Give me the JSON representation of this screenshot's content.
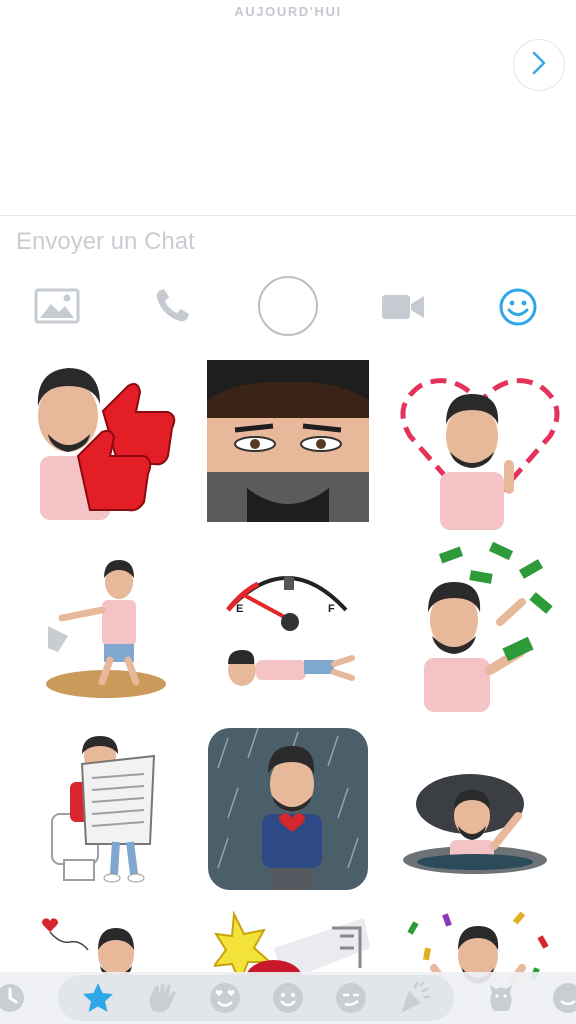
{
  "chat": {
    "date_label": "AUJOURD'HUI",
    "input_placeholder": "Envoyer un Chat"
  },
  "toolbar": {
    "icons": [
      "image-icon",
      "phone-icon",
      "capture-button",
      "video-icon",
      "smiley-icon"
    ],
    "active": "smiley-icon",
    "active_color": "#2fa6e8"
  },
  "stickers": [
    {
      "name": "thumbs-up-foam-finger-sticker"
    },
    {
      "name": "eyes-closeup-sticker"
    },
    {
      "name": "heart-outline-sticker"
    },
    {
      "name": "kick-sticker"
    },
    {
      "name": "empty-fuel-gauge-sticker"
    },
    {
      "name": "money-rain-sticker"
    },
    {
      "name": "toilet-newspaper-sticker"
    },
    {
      "name": "rain-broken-heart-sticker"
    },
    {
      "name": "manhole-wave-sticker"
    },
    {
      "name": "balloon-heart-sticker"
    },
    {
      "name": "crash-explosion-sticker"
    },
    {
      "name": "confetti-celebration-sticker"
    }
  ],
  "tray": {
    "icons": [
      "recent-clock-icon",
      "favorites-star-icon",
      "waving-hand-icon",
      "heart-eyes-face-icon",
      "smiling-face-icon",
      "smirking-face-icon",
      "party-popper-icon",
      "hamster-icon",
      "more-face-icon"
    ],
    "active": "favorites-star-icon",
    "active_color": "#2fa6e8"
  }
}
